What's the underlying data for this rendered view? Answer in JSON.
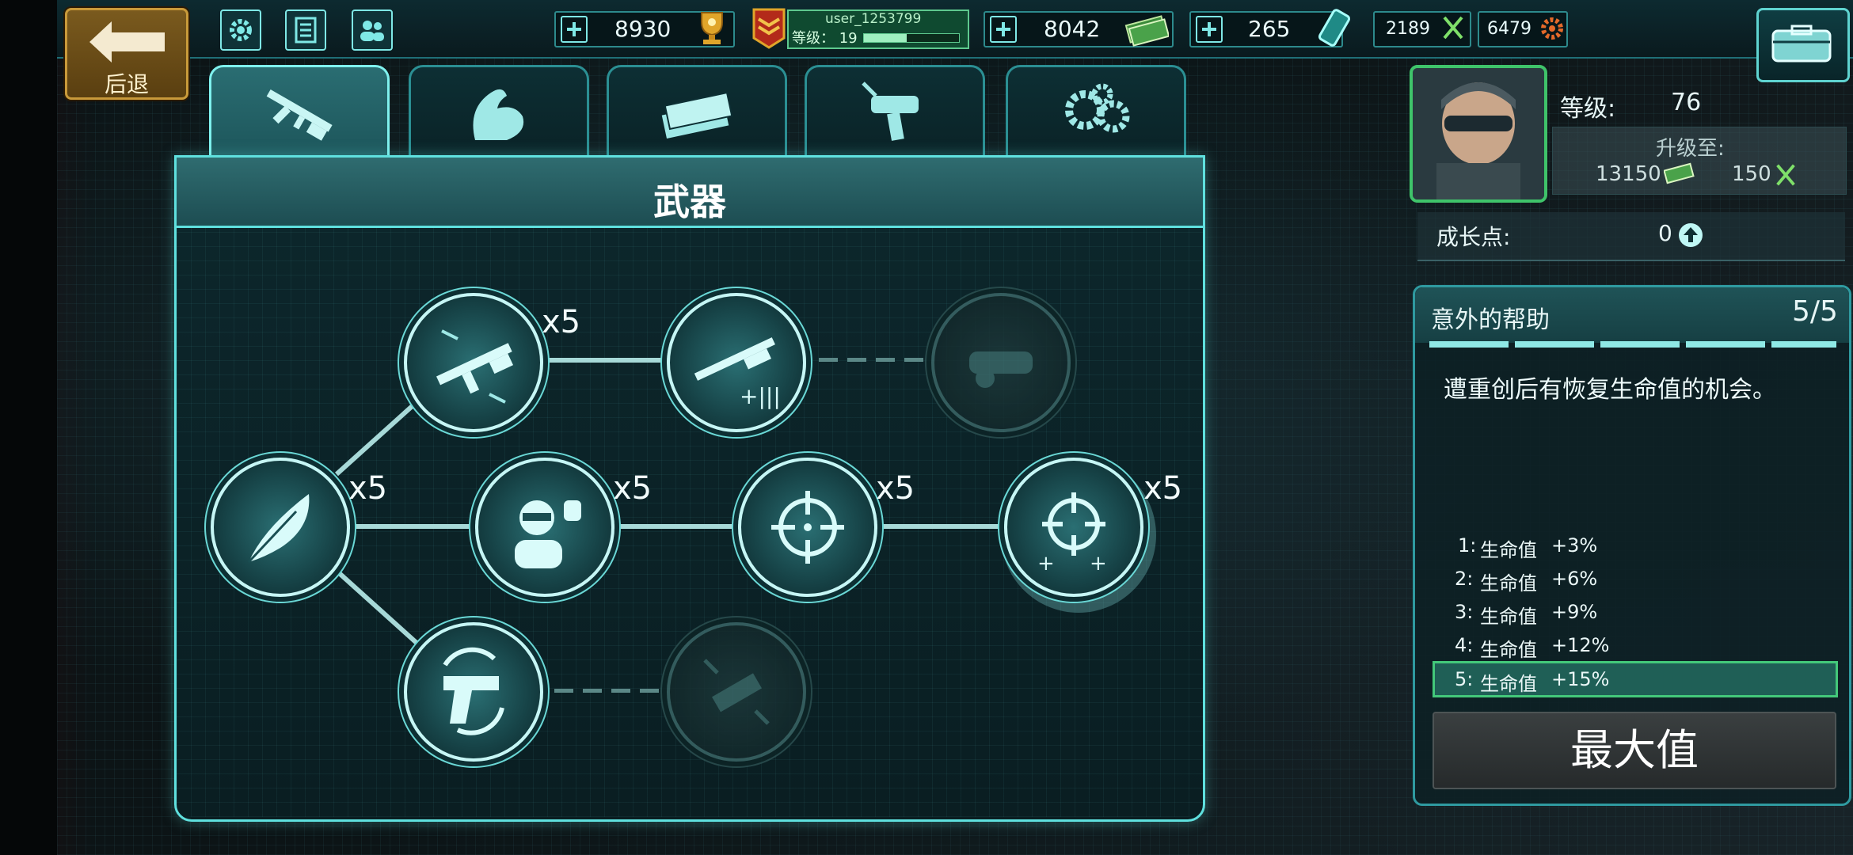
{
  "topbar": {
    "back_label": "后退",
    "trophy_value": "8930",
    "username": "user_1253799",
    "level_label": "等级：",
    "level_value": "19",
    "level_progress": 0.45,
    "cash_value": "8042",
    "gems_value": "265",
    "dna_value": "2189",
    "parts_value": "6479",
    "icons": [
      "gear-icon",
      "notes-icon",
      "friends-icon",
      "info-icon",
      "trophy-icon",
      "rank-icon",
      "cash-icon",
      "battery-icon",
      "dna-icon",
      "parts-icon",
      "case-icon"
    ]
  },
  "tabs": [
    {
      "id": "weapons",
      "icon": "rifle-icon",
      "active": true
    },
    {
      "id": "strength",
      "icon": "muscle-icon",
      "active": false
    },
    {
      "id": "money",
      "icon": "cash-stack-icon",
      "active": false
    },
    {
      "id": "medic",
      "icon": "syringe-gun-icon",
      "active": false
    },
    {
      "id": "gear",
      "icon": "gears-icon",
      "active": false
    }
  ],
  "panel": {
    "title": "武器"
  },
  "skills": {
    "multipliers": {
      "rifle_burst": "x5",
      "feather": "x5",
      "soldier": "x5",
      "crosshair": "x5",
      "crosshair_plus": "x5"
    }
  },
  "profile": {
    "level_label": "等级:",
    "level_value": "76",
    "upgrade_label": "升级至:",
    "upgrade_cash": "13150",
    "upgrade_dna": "150",
    "growth_label": "成长点:",
    "growth_value": "0"
  },
  "skill_card": {
    "title": "意外的帮助",
    "progress": "5/5",
    "description": "遭重创后有恢复生命值的机会。",
    "levels": [
      {
        "num": "1:",
        "stat": "生命值",
        "bonus": "+3%"
      },
      {
        "num": "2:",
        "stat": "生命值",
        "bonus": "+6%"
      },
      {
        "num": "3:",
        "stat": "生命值",
        "bonus": "+9%"
      },
      {
        "num": "4:",
        "stat": "生命值",
        "bonus": "+12%"
      },
      {
        "num": "5:",
        "stat": "生命值",
        "bonus": "+15%"
      }
    ],
    "max_button": "最大值"
  },
  "colors": {
    "accent": "#5fe0de",
    "brand_gold": "#c99a3a",
    "select_green": "#43c87a"
  }
}
